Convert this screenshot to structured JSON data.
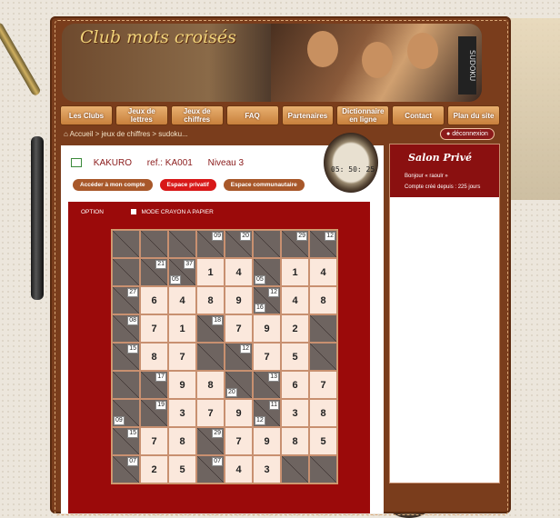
{
  "site": {
    "logo_text": "Club mots croisés",
    "banner_sudoku": "SUDOKU"
  },
  "nav": [
    "Les Clubs",
    "Jeux de lettres",
    "Jeux de chiffres",
    "FAQ",
    "Partenaires",
    "Dictionnaire en ligne",
    "Contact",
    "Plan du site"
  ],
  "breadcrumb": "Accueil > jeux de chiffres > sudoku...",
  "logout_label": "déconnexion",
  "puzzle": {
    "type": "KAKURO",
    "ref": "ref.: KA001",
    "level": "Niveau 3"
  },
  "buttons": {
    "account": "Accéder à mon compte",
    "private": "Espace privatif",
    "community": "Espace communautaire"
  },
  "options": {
    "option_label": "OPTION",
    "pencil_label": "MODE CRAYON A PAPIER"
  },
  "timer": "05: 50: 25",
  "salon": {
    "title": "Salon Privé",
    "greeting": "Bonjour « raoulr »",
    "account_age": "Compte créé depuis : 225 jours"
  },
  "grid": [
    [
      {
        "t": "b"
      },
      {
        "t": "b"
      },
      {
        "t": "b"
      },
      {
        "t": "b",
        "tr": "09"
      },
      {
        "t": "b",
        "tr": "20"
      },
      {
        "t": "b"
      },
      {
        "t": "b",
        "tr": "29"
      },
      {
        "t": "b",
        "tr": "12"
      }
    ],
    [
      {
        "t": "b"
      },
      {
        "t": "b",
        "tr": "21"
      },
      {
        "t": "b",
        "tr": "37",
        "bl": "05"
      },
      {
        "t": "w",
        "v": "1"
      },
      {
        "t": "w",
        "v": "4"
      },
      {
        "t": "b",
        "bl": "05"
      },
      {
        "t": "w",
        "v": "1"
      },
      {
        "t": "w",
        "v": "4"
      }
    ],
    [
      {
        "t": "b",
        "tr": "27"
      },
      {
        "t": "w",
        "v": "6"
      },
      {
        "t": "w",
        "v": "4"
      },
      {
        "t": "w",
        "v": "8"
      },
      {
        "t": "w",
        "v": "9"
      },
      {
        "t": "b",
        "tr": "12",
        "bl": "16"
      },
      {
        "t": "w",
        "v": "4"
      },
      {
        "t": "w",
        "v": "8"
      }
    ],
    [
      {
        "t": "b",
        "tr": "08"
      },
      {
        "t": "w",
        "v": "7"
      },
      {
        "t": "w",
        "v": "1"
      },
      {
        "t": "b",
        "tr": "18"
      },
      {
        "t": "w",
        "v": "7"
      },
      {
        "t": "w",
        "v": "9"
      },
      {
        "t": "w",
        "v": "2"
      },
      {
        "t": "b"
      }
    ],
    [
      {
        "t": "b",
        "tr": "15"
      },
      {
        "t": "w",
        "v": "8"
      },
      {
        "t": "w",
        "v": "7"
      },
      {
        "t": "b"
      },
      {
        "t": "b",
        "tr": "12"
      },
      {
        "t": "w",
        "v": "7"
      },
      {
        "t": "w",
        "v": "5"
      },
      {
        "t": "b"
      }
    ],
    [
      {
        "t": "b"
      },
      {
        "t": "b",
        "tr": "17"
      },
      {
        "t": "w",
        "v": "9"
      },
      {
        "t": "w",
        "v": "8"
      },
      {
        "t": "b",
        "bl": "20"
      },
      {
        "t": "b",
        "tr": "13"
      },
      {
        "t": "w",
        "v": "6"
      },
      {
        "t": "w",
        "v": "7"
      }
    ],
    [
      {
        "t": "b",
        "bl": "09"
      },
      {
        "t": "b",
        "tr": "19"
      },
      {
        "t": "w",
        "v": "3"
      },
      {
        "t": "w",
        "v": "7"
      },
      {
        "t": "w",
        "v": "9"
      },
      {
        "t": "b",
        "tr": "11",
        "bl": "12"
      },
      {
        "t": "w",
        "v": "3"
      },
      {
        "t": "w",
        "v": "8"
      }
    ],
    [
      {
        "t": "b",
        "tr": "15"
      },
      {
        "t": "w",
        "v": "7"
      },
      {
        "t": "w",
        "v": "8"
      },
      {
        "t": "b",
        "tr": "29"
      },
      {
        "t": "w",
        "v": "7"
      },
      {
        "t": "w",
        "v": "9"
      },
      {
        "t": "w",
        "v": "8"
      },
      {
        "t": "w",
        "v": "5"
      }
    ],
    [
      {
        "t": "b",
        "tr": "07"
      },
      {
        "t": "w",
        "v": "2"
      },
      {
        "t": "w",
        "v": "5"
      },
      {
        "t": "b",
        "tr": "07"
      },
      {
        "t": "w",
        "v": "4"
      },
      {
        "t": "w",
        "v": "3"
      },
      {
        "t": "b"
      },
      {
        "t": "b"
      }
    ]
  ]
}
